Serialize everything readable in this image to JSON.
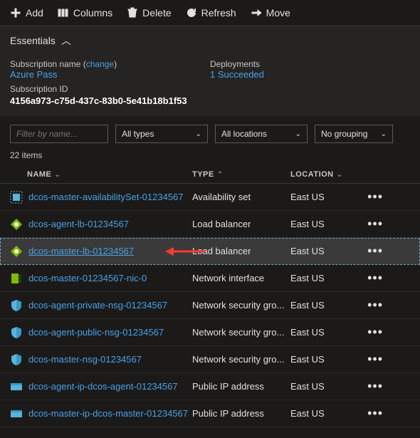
{
  "toolbar": {
    "add": "Add",
    "columns": "Columns",
    "delete": "Delete",
    "refresh": "Refresh",
    "move": "Move"
  },
  "essentials": {
    "title": "Essentials",
    "subscription_label": "Subscription name",
    "change_text": "change",
    "subscription_name": "Azure Pass",
    "subscription_id_label": "Subscription ID",
    "subscription_id": "4156a973-c75d-437c-83b0-5e41b18b1f53",
    "deployments_label": "Deployments",
    "deployments_value": "1 Succeeded"
  },
  "filters": {
    "name_placeholder": "Filter by name...",
    "types": "All types",
    "locations": "All locations",
    "grouping": "No grouping"
  },
  "count": "22 items",
  "columns": {
    "name": "NAME",
    "type": "TYPE",
    "location": "LOCATION"
  },
  "rows": [
    {
      "icon": "availset",
      "name": "dcos-master-availabilitySet-01234567",
      "type": "Availability set",
      "location": "East US",
      "selected": false
    },
    {
      "icon": "lb",
      "name": "dcos-agent-lb-01234567",
      "type": "Load balancer",
      "location": "East US",
      "selected": false
    },
    {
      "icon": "lb",
      "name": "dcos-master-lb-01234567",
      "type": "Load balancer",
      "location": "East US",
      "selected": true
    },
    {
      "icon": "nic",
      "name": "dcos-master-01234567-nic-0",
      "type": "Network interface",
      "location": "East US",
      "selected": false
    },
    {
      "icon": "nsg",
      "name": "dcos-agent-private-nsg-01234567",
      "type": "Network security gro...",
      "location": "East US",
      "selected": false
    },
    {
      "icon": "nsg",
      "name": "dcos-agent-public-nsg-01234567",
      "type": "Network security gro...",
      "location": "East US",
      "selected": false
    },
    {
      "icon": "nsg",
      "name": "dcos-master-nsg-01234567",
      "type": "Network security gro...",
      "location": "East US",
      "selected": false
    },
    {
      "icon": "pip",
      "name": "dcos-agent-ip-dcos-agent-01234567",
      "type": "Public IP address",
      "location": "East US",
      "selected": false
    },
    {
      "icon": "pip",
      "name": "dcos-master-ip-dcos-master-01234567",
      "type": "Public IP address",
      "location": "East US",
      "selected": false
    }
  ]
}
